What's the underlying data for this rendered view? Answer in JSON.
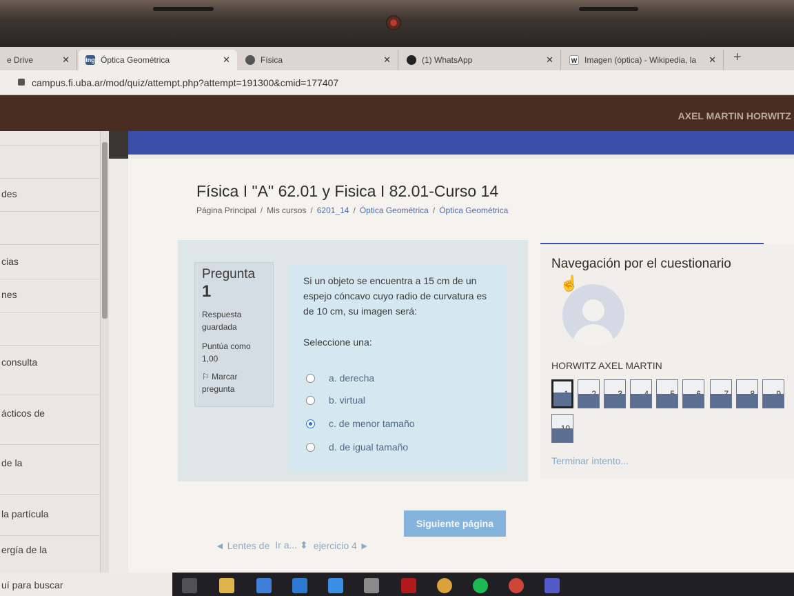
{
  "browser": {
    "tabs": [
      {
        "label": "e Drive",
        "icon": "drive-icon"
      },
      {
        "label": "Óptica Geométrica",
        "icon": "moodle-icon",
        "fav_text": "ing"
      },
      {
        "label": "Física",
        "icon": "chrome-icon"
      },
      {
        "label": "(1) WhatsApp",
        "icon": "whatsapp-icon"
      },
      {
        "label": "Imagen (óptica) - Wikipedia, la",
        "icon": "wikipedia-icon",
        "fav_text": "W"
      }
    ],
    "close_glyph": "✕",
    "new_tab": "+",
    "url": "campus.fi.uba.ar/mod/quiz/attempt.php?attempt=191300&cmid=177407"
  },
  "header": {
    "user_name": "AXEL MARTIN HORWITZ"
  },
  "sidebar": {
    "items": [
      "des",
      "cias",
      "nes",
      "consulta",
      "ácticos de",
      "de la",
      "la partícula",
      "ergía de la"
    ]
  },
  "course": {
    "title": "Física I \"A\" 62.01 y Fisica I 82.01-Curso 14",
    "breadcrumb": [
      "Página Principal",
      "Mis cursos",
      "6201_14",
      "Óptica Geométrica",
      "Óptica Geométrica"
    ],
    "separator": "/"
  },
  "question": {
    "heading": "Pregunta",
    "number": "1",
    "status": "Respuesta guardada",
    "points": "Puntúa como 1,00",
    "flag_label": "Marcar pregunta",
    "text": "Si un objeto se encuentra a 15 cm de un espejo cóncavo cuyo radio de curvatura es de 10 cm, su imagen será:",
    "prompt": "Seleccione una:",
    "options": [
      {
        "label": "a. derecha",
        "selected": false
      },
      {
        "label": "b. virtual",
        "selected": false
      },
      {
        "label": "c. de menor tamaño",
        "selected": true
      },
      {
        "label": "d. de igual tamaño",
        "selected": false
      }
    ]
  },
  "next_button": "Siguiente página",
  "bottom_nav": {
    "prev_link": "◄ Lentes de",
    "jump_label": "Ir a...",
    "jump_arrow": "⬍",
    "next_link": "ejercicio 4 ►"
  },
  "quiz_nav": {
    "title": "Navegación por el cuestionario",
    "student": "HORWITZ AXEL MARTIN",
    "buttons": [
      "1",
      "2",
      "3",
      "4",
      "5",
      "6",
      "7",
      "8",
      "9",
      "10"
    ],
    "current": "1",
    "finish_link": "Terminar intento..."
  },
  "taskbar": {
    "search_text": "uí para buscar",
    "icons": [
      "task-view-icon",
      "file-explorer-icon",
      "store-icon",
      "mail-icon",
      "dropbox-icon",
      "winamp-icon",
      "netflix-icon",
      "chrome-icon",
      "spotify-icon",
      "chrome-icon",
      "teams-icon"
    ]
  },
  "colors": {
    "accent_blue": "#3a4fa8",
    "header_brown": "#4a2d22",
    "link_blue": "#4b6baa",
    "radio_checked": "#2f6fd0",
    "nav_fill": "#5b6f93"
  }
}
